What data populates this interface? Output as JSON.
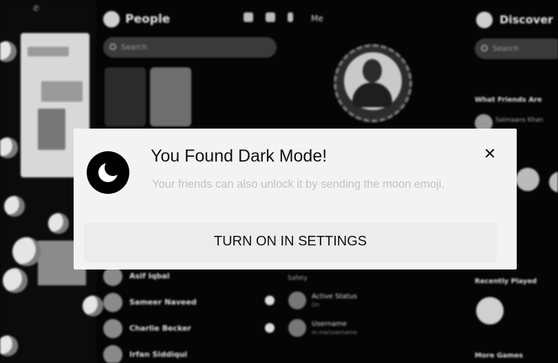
{
  "people": {
    "title": "People",
    "search_placeholder": "Search",
    "contacts": [
      "Asif Iqbal",
      "Sameer Naveed",
      "Charlie Becker",
      "Irfan Siddiqui"
    ]
  },
  "me": {
    "title": "Me",
    "settings": [
      {
        "title": "Active Status",
        "sub": "On"
      },
      {
        "title": "Username",
        "sub": "m.me/username"
      }
    ],
    "settings_label": "Safety"
  },
  "discover": {
    "title": "Discover",
    "search_placeholder": "Search",
    "section_what_friends": "What Friends Are",
    "friend_name": "Salmaans Khan",
    "section_recently_played": "Recently Played",
    "section_more_games": "More Games"
  },
  "modal": {
    "title": "You Found Dark Mode!",
    "description": "Your friends can also unlock it by sending the moon emoji.",
    "close_glyph": "✕",
    "action_label": "TURN ON IN SETTINGS",
    "icon": "moon-icon"
  }
}
